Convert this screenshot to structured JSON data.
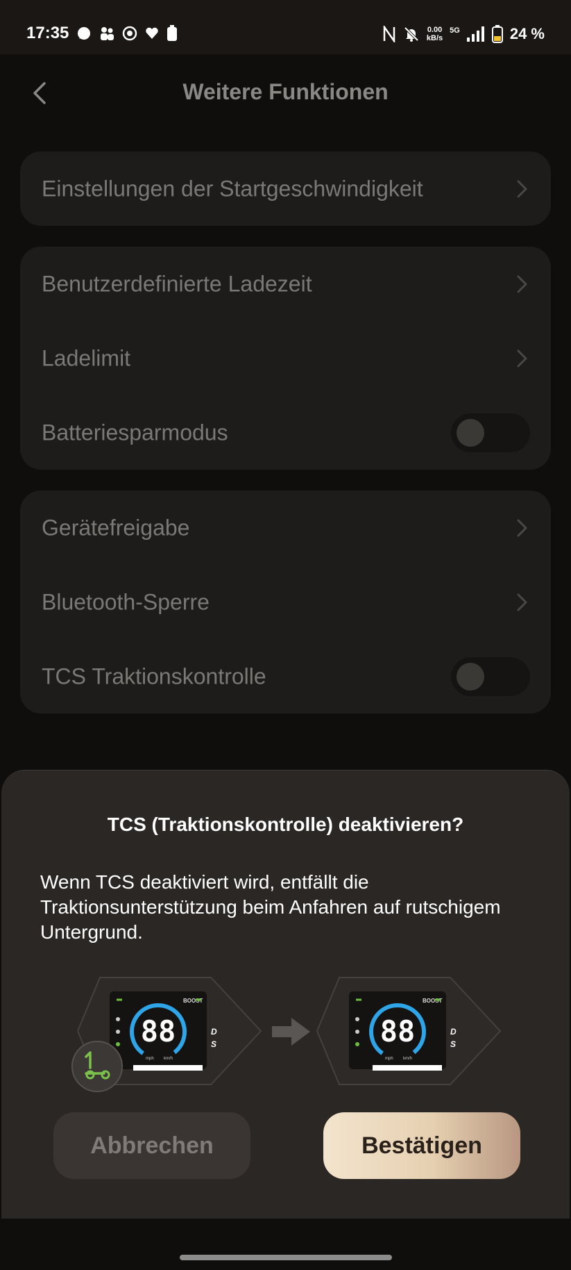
{
  "status_bar": {
    "time": "17:35",
    "net_speed_value": "0.00",
    "net_speed_unit": "kB/s",
    "network": "5G",
    "battery_percent": "24 %",
    "left_icons": [
      "chat-bubble-icon",
      "people-icon",
      "lion-icon",
      "heart-icon",
      "battery-small-icon"
    ],
    "right_icons": [
      "nfc-icon",
      "bell-off-icon",
      "signal-bars-icon",
      "battery-icon"
    ]
  },
  "header": {
    "title": "Weitere Funktionen",
    "back_icon": "chevron-left-icon"
  },
  "groups": [
    {
      "items": [
        {
          "label": "Einstellungen der Startgeschwindigkeit",
          "control": "chevron"
        }
      ]
    },
    {
      "items": [
        {
          "label": "Benutzerdefinierte Ladezeit",
          "control": "chevron"
        },
        {
          "label": "Ladelimit",
          "control": "chevron"
        },
        {
          "label": "Batteriesparmodus",
          "control": "toggle",
          "on": false
        }
      ]
    },
    {
      "items": [
        {
          "label": "Gerätefreigabe",
          "control": "chevron"
        },
        {
          "label": "Bluetooth-Sperre",
          "control": "chevron"
        },
        {
          "label": "TCS Traktionskontrolle",
          "control": "toggle",
          "on": false
        }
      ]
    }
  ],
  "dialog": {
    "title": "TCS (Traktionskontrolle) deaktivieren?",
    "message": "Wenn TCS deaktiviert wird, entfällt die Traktionsunterstützung beim Anfahren auf rutschigem Untergrund.",
    "illustration": {
      "display_speed": "88",
      "unit_left": "mph",
      "unit_right": "km/h",
      "boost_label": "BOOST",
      "gear_d": "D",
      "gear_s": "S",
      "badge_icon": "tcs-scooter-icon",
      "arrow_icon": "arrow-right-icon"
    },
    "cancel_label": "Abbrechen",
    "confirm_label": "Bestätigen"
  },
  "colors": {
    "accent_blue": "#2fa4e7",
    "accent_green": "#6bbf3a",
    "confirm_gradient_start": "#f3e4cd",
    "confirm_gradient_end": "#b89781",
    "sheet_bg": "#2b2725",
    "card_bg": "#1e1c1a"
  }
}
